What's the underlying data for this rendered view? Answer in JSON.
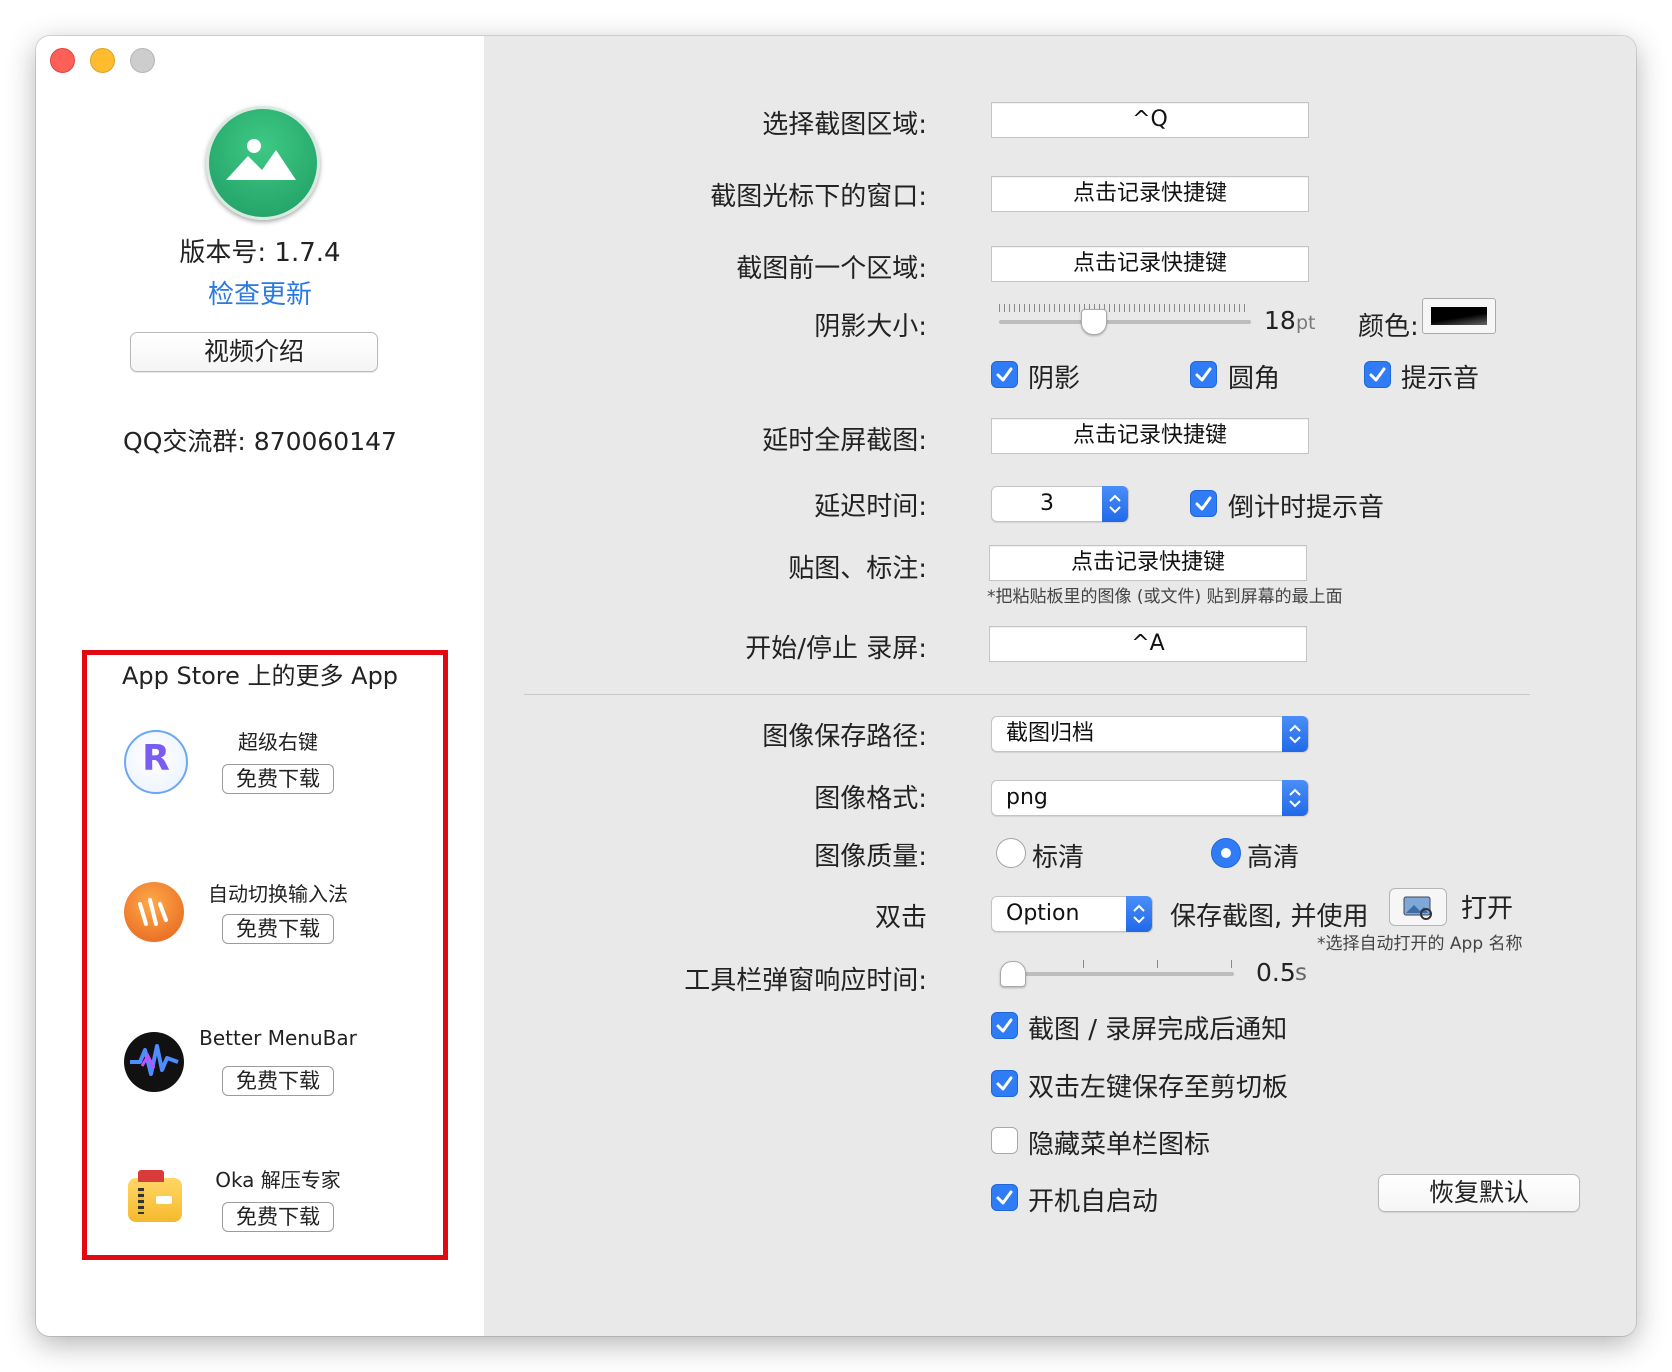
{
  "sidebar": {
    "version_label": "版本号: 1.7.4",
    "check_update": "检查更新",
    "video_button": "视频介绍",
    "qq_group": "QQ交流群:  870060147",
    "more_apps": {
      "title": "App Store 上的更多 App",
      "apps": [
        {
          "name": "超级右键",
          "button": "免费下载",
          "icon": "super-right-click-icon"
        },
        {
          "name": "自动切换输入法",
          "button": "免费下载",
          "icon": "auto-input-switch-icon"
        },
        {
          "name": "Better MenuBar",
          "button": "免费下载",
          "icon": "better-menubar-icon"
        },
        {
          "name": "Oka 解压专家",
          "button": "免费下载",
          "icon": "oka-unarchiver-icon"
        }
      ]
    }
  },
  "settings": {
    "select_area": {
      "label": "选择截图区域:",
      "value": "^Q"
    },
    "window_under_cursor": {
      "label": "截图光标下的窗口:",
      "value": "点击记录快捷键"
    },
    "previous_area": {
      "label": "截图前一个区域:",
      "value": "点击记录快捷键"
    },
    "shadow_size": {
      "label": "阴影大小:",
      "value": "18",
      "unit": "pt",
      "level": 0.37
    },
    "color": {
      "label": "颜色:",
      "swatch": "#000000"
    },
    "checks_row": [
      {
        "label": "阴影",
        "checked": true
      },
      {
        "label": "圆角",
        "checked": true
      },
      {
        "label": "提示音",
        "checked": true
      }
    ],
    "delayed_fullscreen": {
      "label": "延时全屏截图:",
      "value": "点击记录快捷键"
    },
    "delay_time": {
      "label": "延迟时间:",
      "value": "3"
    },
    "countdown_sound": {
      "label": "倒计时提示音",
      "checked": true
    },
    "pin_annotate": {
      "label": "贴图、标注:",
      "value": "点击记录快捷键",
      "note": "*把粘贴板里的图像 (或文件) 贴到屏幕的最上面"
    },
    "record": {
      "label": "开始/停止 录屏:",
      "value": "^A"
    },
    "save_path": {
      "label": "图像保存路径:",
      "value": "截图归档"
    },
    "format": {
      "label": "图像格式:",
      "value": "png"
    },
    "quality": {
      "label": "图像质量:",
      "options": [
        "标清",
        "高清"
      ],
      "selected": "高清"
    },
    "double_click": {
      "label": "双击",
      "modifier": "Option",
      "text": "保存截图, 并使用",
      "open": "打开",
      "note": "*选择自动打开的 App 名称"
    },
    "toolbar_delay": {
      "label": "工具栏弹窗响应时间:",
      "value": "0.5",
      "unit": "s",
      "level": 0.0
    },
    "options": [
      {
        "label": "截图 / 录屏完成后通知",
        "checked": true
      },
      {
        "label": "双击左键保存至剪切板",
        "checked": true
      },
      {
        "label": "隐藏菜单栏图标",
        "checked": false
      },
      {
        "label": "开机自启动",
        "checked": true
      }
    ],
    "restore_defaults": "恢复默认"
  },
  "colors": {
    "accent": "#2f7cf6",
    "link": "#2a7ae2",
    "highlight_box": "#e20a12"
  }
}
